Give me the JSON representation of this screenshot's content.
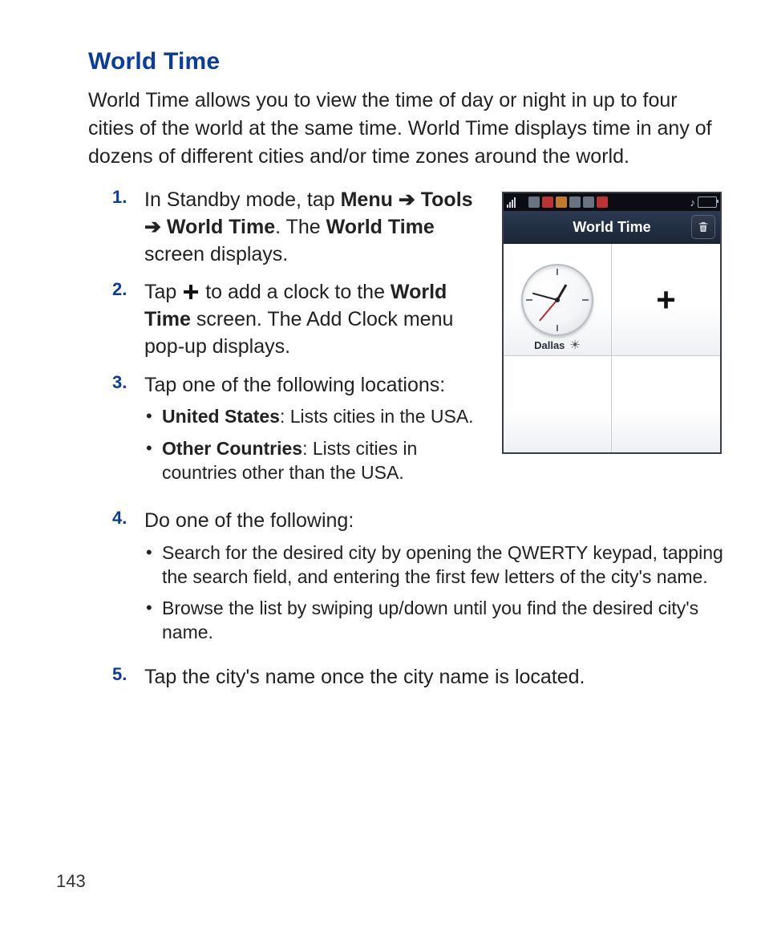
{
  "heading": "World Time",
  "intro": "World Time allows you to view the time of day or night in up to four cities of the world at the same time. World Time displays time in any of dozens of different cities and/or time zones around the world.",
  "steps": {
    "s1": {
      "num": "1.",
      "pre": "In Standby mode, tap ",
      "menu": "Menu",
      "arrow1": "➔",
      "tools": "Tools",
      "arrow2": "➔",
      "wt": "World Time",
      "mid": ". The ",
      "wt2": "World Time",
      "post": " screen displays."
    },
    "s2": {
      "num": "2.",
      "pre": "Tap ",
      "mid": " to add a clock to the ",
      "wt": "World Time",
      "post": " screen. The Add Clock menu pop-up displays."
    },
    "s3": {
      "num": "3.",
      "text": "Tap one of the following locations:",
      "b1_label": "United States",
      "b1_rest": ": Lists cities in the USA.",
      "b2_label": "Other Countries",
      "b2_rest": ": Lists cities in countries other than the USA."
    },
    "s4": {
      "num": "4.",
      "text": "Do one of the following:",
      "b1": "Search for the desired city by opening the QWERTY keypad, tapping the search field, and entering the first few letters of the city's name.",
      "b2": "Browse the list by swiping up/down until you find the desired city's name."
    },
    "s5": {
      "num": "5.",
      "text": "Tap the city's name once the city name is located."
    }
  },
  "page_number": "143",
  "screenshot": {
    "title": "World Time",
    "city": "Dallas"
  }
}
